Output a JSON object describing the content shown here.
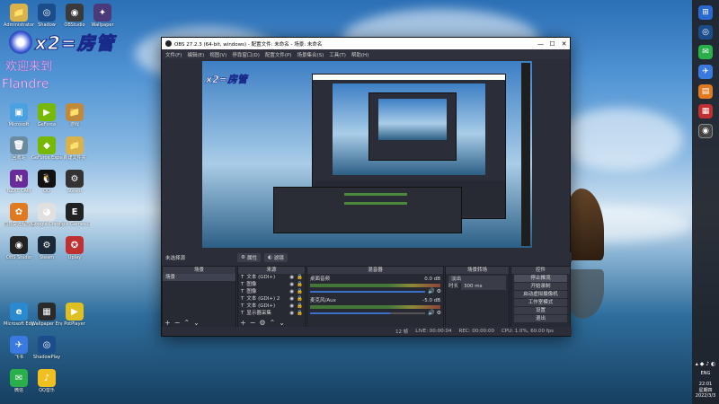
{
  "desktop": {
    "overlay_logo": "x2=房管",
    "overlay_line1": "欢迎来到",
    "overlay_line2": "Flandre",
    "icons": [
      {
        "label": "Administrator",
        "color": "#d9b34a",
        "glyph": "📁",
        "col": 0,
        "row": 0
      },
      {
        "label": "Shadow",
        "color": "#1b4d8a",
        "glyph": "◎",
        "col": 1,
        "row": 0
      },
      {
        "label": "OBStudio",
        "color": "#3a3a3a",
        "glyph": "◉",
        "col": 2,
        "row": 0
      },
      {
        "label": "Wallpaper",
        "color": "#4a3a7a",
        "glyph": "✦",
        "col": 3,
        "row": 0
      },
      {
        "label": "Microsoft",
        "color": "#4aa0e0",
        "glyph": "▣",
        "col": 0,
        "row": 3
      },
      {
        "label": "GeForce",
        "color": "#76b900",
        "glyph": "▶",
        "col": 1,
        "row": 3
      },
      {
        "label": "游戏",
        "color": "#c08a3a",
        "glyph": "📁",
        "col": 2,
        "row": 3
      },
      {
        "label": "回收站",
        "color": "#6a8aa0",
        "glyph": "🗑",
        "col": 0,
        "row": 4
      },
      {
        "label": "GeForce Experience",
        "color": "#76b900",
        "glyph": "◆",
        "col": 1,
        "row": 4
      },
      {
        "label": "新建文件夹",
        "color": "#d9b34a",
        "glyph": "📁",
        "col": 2,
        "row": 4
      },
      {
        "label": "NZXT CAM",
        "color": "#6a2a9a",
        "glyph": "N",
        "col": 0,
        "row": 5
      },
      {
        "label": "QQ",
        "color": "#111",
        "glyph": "🐧",
        "col": 1,
        "row": 5
      },
      {
        "label": "Steam",
        "color": "#333",
        "glyph": "⚙",
        "col": 2,
        "row": 5
      },
      {
        "label": "向日葵远程控制",
        "color": "#e07a20",
        "glyph": "✿",
        "col": 0,
        "row": 6
      },
      {
        "label": "Google Chrome",
        "color": "#e0e0e0",
        "glyph": "◕",
        "col": 1,
        "row": 6
      },
      {
        "label": "Epic Games Launcher",
        "color": "#222",
        "glyph": "E",
        "col": 2,
        "row": 6
      },
      {
        "label": "OBS Studio",
        "color": "#222",
        "glyph": "◉",
        "col": 0,
        "row": 7
      },
      {
        "label": "Steam",
        "color": "#1b2838",
        "glyph": "⚙",
        "col": 1,
        "row": 7
      },
      {
        "label": "Uplay",
        "color": "#c03030",
        "glyph": "✪",
        "col": 2,
        "row": 7
      },
      {
        "label": "Microsoft Edge",
        "color": "#2a8ad0",
        "glyph": "e",
        "col": 0,
        "row": 9
      },
      {
        "label": "Wallpaper Engine",
        "color": "#2a2a2a",
        "glyph": "▦",
        "col": 1,
        "row": 9
      },
      {
        "label": "PotPlayer",
        "color": "#e0c020",
        "glyph": "▶",
        "col": 2,
        "row": 9
      },
      {
        "label": "飞书",
        "color": "#3a7ae0",
        "glyph": "✈",
        "col": 0,
        "row": 10
      },
      {
        "label": "ShadowPlay",
        "color": "#1b4d8a",
        "glyph": "◎",
        "col": 1,
        "row": 10
      },
      {
        "label": "微信",
        "color": "#2ab04a",
        "glyph": "✉",
        "col": 0,
        "row": 11
      },
      {
        "label": "QQ音乐",
        "color": "#f0c020",
        "glyph": "♪",
        "col": 1,
        "row": 11
      }
    ]
  },
  "obs": {
    "title": "OBS 27.2.3 (64-bit, windows) - 配置文件: 未命名 - 场景: 未命名",
    "menu": [
      "文件(F)",
      "编辑(E)",
      "视图(V)",
      "停靠窗口(D)",
      "配置文件(P)",
      "场景集合(S)",
      "工具(T)",
      "帮助(H)"
    ],
    "status_source": "未选择源",
    "props_btn": "属性",
    "filters_btn": "滤镜",
    "docks": {
      "scenes": {
        "title": "场景",
        "items": [
          "场景"
        ]
      },
      "sources": {
        "title": "来源",
        "items": [
          "文本 (GDI+)",
          "图像",
          "图像",
          "文本 (GDI+) 2",
          "文本 (GDI+)",
          "显示器采集"
        ]
      },
      "mixer": {
        "title": "混音器",
        "channels": [
          {
            "name": "桌面音频",
            "db": "0.0 dB"
          },
          {
            "name": "麦克风/Aux",
            "db": "-5.0 dB"
          }
        ]
      },
      "transitions": {
        "title": "场景转场",
        "type": "淡出",
        "duration_label": "时长",
        "duration": "300 ms"
      },
      "controls": {
        "title": "控件",
        "buttons": [
          "停止推流",
          "开始录制",
          "启动虚拟摄像机",
          "工作室模式",
          "设置",
          "退出"
        ]
      }
    },
    "statusbar": {
      "live": "LIVE: 00:00:04",
      "rec": "REC: 00:00:00",
      "cpu": "CPU: 1.0%, 60.00 fps",
      "dropped": "12 帧"
    }
  },
  "taskbar": {
    "lang": "ENG",
    "time": "22:01",
    "day": "星期四",
    "date": "2022/3/3"
  }
}
